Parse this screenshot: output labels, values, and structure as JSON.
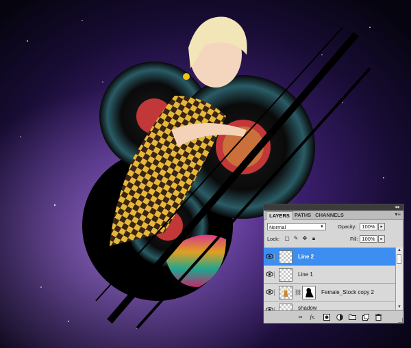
{
  "panel": {
    "collapse_glyph": "◂◂",
    "tabs": [
      {
        "label": "LAYERS",
        "active": true
      },
      {
        "label": "PATHS",
        "active": false
      },
      {
        "label": "CHANNELS",
        "active": false
      }
    ],
    "menu_icon": "panel-menu-icon",
    "blend_mode": "Normal",
    "opacity_label": "Opacity:",
    "opacity_value": "100%",
    "lock_label": "Lock:",
    "fill_label": "Fill:",
    "fill_value": "100%",
    "layers": [
      {
        "name": "Line 2",
        "selected": true,
        "visible": true
      },
      {
        "name": "Line 1",
        "selected": false,
        "visible": true
      },
      {
        "name": "Female_Stock copy 2",
        "selected": false,
        "visible": true,
        "has_mask": true
      },
      {
        "name": "shadow",
        "selected": false,
        "visible": true
      }
    ],
    "bottom_icons": [
      "link-layers-icon",
      "fx-icon",
      "add-mask-icon",
      "adjustment-layer-icon",
      "new-group-icon",
      "new-layer-icon",
      "delete-layer-icon"
    ],
    "bottom_fx_label": "fx."
  },
  "colors": {
    "selection": "#3c8ef0",
    "panel_bg": "#d6d6d6"
  }
}
